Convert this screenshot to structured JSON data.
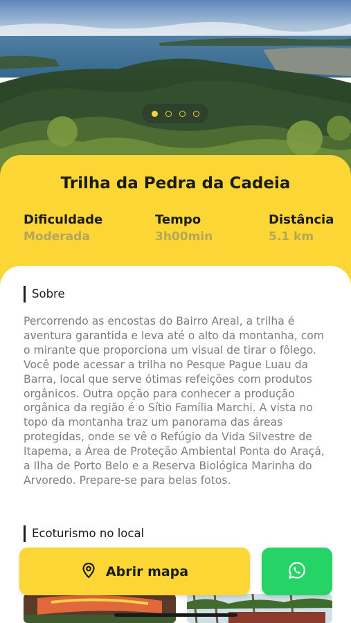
{
  "hero": {
    "slides": [
      {
        "active": true
      },
      {
        "active": false
      },
      {
        "active": false
      },
      {
        "active": false
      }
    ]
  },
  "trail": {
    "title": "Trilha da Pedra da Cadeia",
    "stats": {
      "difficulty": {
        "label": "Dificuldade",
        "value": "Moderada"
      },
      "time": {
        "label": "Tempo",
        "value": "3h00min"
      },
      "distance": {
        "label": "Distância",
        "value": "5.1 km"
      }
    }
  },
  "about": {
    "heading": "Sobre",
    "text": "Percorrendo as encostas do Bairro Areal, a trilha é aventura garantida e leva até o alto da montanha, com o mirante que proporciona um visual de tirar o fôlego. Você pode acessar a trilha no Pesque Pague Luau da Barra, local que serve ótimas refeições com produtos orgânicos. Outra opção para conhecer a produção orgânica da região é o Sítio Família Marchi. A vista no topo da montanha traz um panorama das áreas protegidas, onde se vê o Refúgio da Vida Silvestre de Itapema, a Área de Proteção Ambiental Ponta do Araçá, a Ilha de Porto Belo e a Reserva Biológica Marinha do Arvoredo. Prepare-se para belas fotos."
  },
  "ecotourism": {
    "heading": "Ecoturismo no local"
  },
  "actions": {
    "open_map": {
      "label": "Abrir mapa",
      "icon": "map-pin-icon"
    },
    "whatsapp": {
      "icon": "whatsapp-icon"
    }
  },
  "colors": {
    "accent": "#fbd635",
    "whatsapp": "#25d366",
    "muted_text": "#7d7d7d"
  }
}
